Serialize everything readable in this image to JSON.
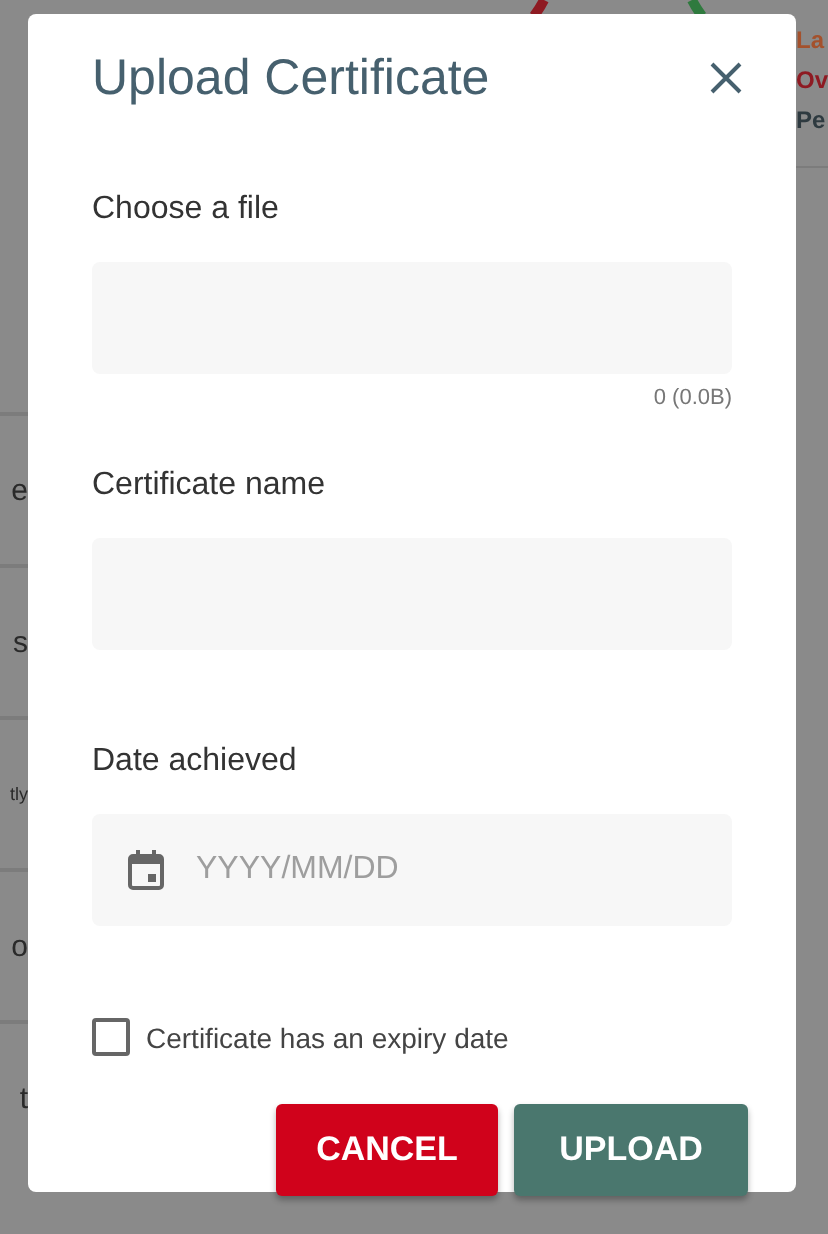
{
  "background": {
    "left_fragments": [
      "e",
      "s",
      "tly",
      "o",
      "t"
    ],
    "right_fragments": [
      {
        "text": "La",
        "color": "#a4512c"
      },
      {
        "text": "Ov",
        "color": "#8e1a22"
      },
      {
        "text": "Pe",
        "color": "#2e3a40"
      }
    ]
  },
  "dialog": {
    "title": "Upload Certificate",
    "fields": [
      {
        "kind": "file",
        "label": "Choose a file",
        "size": "0 (0.0B)"
      },
      {
        "kind": "text",
        "label": "Certificate name"
      },
      {
        "kind": "date",
        "label": "Date achieved",
        "placeholder": "YYYY/MM/DD"
      }
    ],
    "checkbox": {
      "label": "Certificate has an expiry date",
      "checked": false
    },
    "buttons": [
      {
        "kind": "cancel",
        "label": "CANCEL"
      },
      {
        "kind": "primary",
        "label": "UPLOAD"
      }
    ]
  }
}
